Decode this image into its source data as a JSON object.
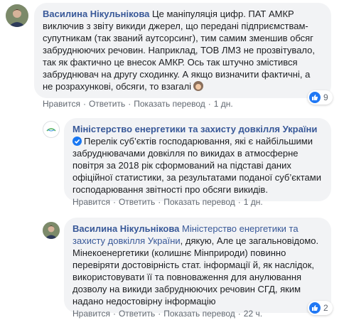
{
  "comments": [
    {
      "author": "Василина Нікульнікова",
      "text": "Це маніпуляція цифр. ПАТ АМКР виключив з звіту викиди джерел, що передані підприємствам-супутникам (так званий аутсорсинг), тим самим зменшив обсяг забруднюючих речовин. Наприклад, ТОВ ЛМЗ не прозвітувало, так як фактично це внесок АМКР. Ось так штучно змістився забруднювач на другу сходинку. А якщо визначити фактичні, а не розрахункові, обсяги, то взагалі",
      "actions": [
        "Нравится",
        "Ответить",
        "Показать перевод"
      ],
      "time": "1 дн.",
      "reaction_count": "9"
    },
    {
      "author": "Міністерство енергетики та захисту довкілля України",
      "text": "Перелік суб’єктів господарювання, які є найбільшими забруднювачами довкілля по викидах в атмосферне повітря за 2018 рік сформований на підставі даних офіційної статистики, за результатами поданої суб’єктами господарювання звітності про обсяги викидів.",
      "actions": [
        "Нравится",
        "Ответить",
        "Показать перевод"
      ],
      "time": "1 дн."
    },
    {
      "author": "Василина Нікульнікова",
      "mention": "Міністерство енергетики та захисту довкілля України",
      "text": ", дякую, Але це загальновідомо. Мінекоенергетики (колишнє Мінприроди) повинно перевіряти достовірність стат. інформації й, як наслідок, використовувати її та повноваження для анулювання дозволу на викиди забруднюючих речовин СГД, яким надано недостовірну інформацію",
      "actions": [
        "Нравится",
        "Ответить",
        "Показать перевод"
      ],
      "time": "22 ч.",
      "reaction_count": "2"
    }
  ],
  "colors": {
    "link": "#385898",
    "bubble": "#f2f3f5",
    "meta": "#606770",
    "like": "#2078f4"
  }
}
